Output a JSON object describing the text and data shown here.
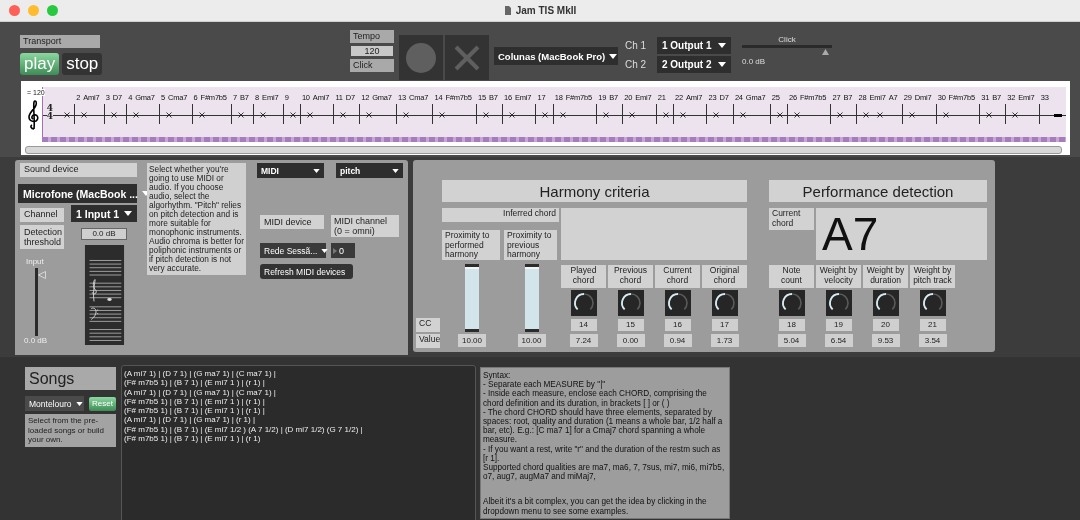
{
  "window": {
    "title": "Jam TIS MkII"
  },
  "transport": {
    "label": "Transport",
    "buttons": [
      {
        "label": "play",
        "selected": true
      },
      {
        "label": "stop",
        "selected": false
      }
    ]
  },
  "tempo": {
    "label": "Tempo",
    "value": "120",
    "click_label": "Click"
  },
  "audio_output": {
    "device": "Colunas (MacBook Pro)",
    "channels": [
      {
        "label": "Ch 1",
        "value": "1 Output 1"
      },
      {
        "label": "Ch 2",
        "value": "2 Output 2"
      }
    ],
    "click_volume": {
      "label": "Click",
      "level": 0.92,
      "reading": "0.0 dB"
    }
  },
  "score": {
    "tempo_mark": "= 120",
    "time_signature": [
      "4",
      "4"
    ],
    "measures": [
      {
        "kind": "chord"
      },
      {
        "kind": "chord",
        "number": "2",
        "chords": [
          "Ami7"
        ]
      },
      {
        "kind": "chord",
        "number": "3",
        "chords": [
          "D7"
        ]
      },
      {
        "kind": "chord",
        "number": "4",
        "chords": [
          "Gma7"
        ]
      },
      {
        "kind": "chord",
        "number": "5",
        "chords": [
          "Cma7"
        ]
      },
      {
        "kind": "chord",
        "number": "6",
        "chords": [
          "F#m7b5"
        ]
      },
      {
        "kind": "chord",
        "number": "7",
        "chords": [
          "B7"
        ]
      },
      {
        "kind": "chord",
        "number": "8",
        "chords": [
          "Emi7"
        ]
      },
      {
        "kind": "chord",
        "number": "9"
      },
      {
        "kind": "chord",
        "number": "10",
        "chords": [
          "Ami7"
        ]
      },
      {
        "kind": "chord",
        "number": "11",
        "chords": [
          "D7"
        ]
      },
      {
        "kind": "chord",
        "number": "12",
        "chords": [
          "Gma7"
        ]
      },
      {
        "kind": "chord",
        "number": "13",
        "chords": [
          "Cma7"
        ]
      },
      {
        "kind": "chord",
        "number": "14",
        "chords": [
          "F#m7b5"
        ]
      },
      {
        "kind": "chord",
        "number": "15",
        "chords": [
          "B7"
        ]
      },
      {
        "kind": "chord",
        "number": "16",
        "chords": [
          "Emi7"
        ]
      },
      {
        "kind": "chord",
        "number": "17"
      },
      {
        "kind": "chord",
        "number": "18",
        "chords": [
          "F#m7b5"
        ]
      },
      {
        "kind": "chord",
        "number": "19",
        "chords": [
          "B7"
        ]
      },
      {
        "kind": "chord",
        "number": "20",
        "chords": [
          "Emi7"
        ]
      },
      {
        "kind": "chord",
        "number": "21"
      },
      {
        "kind": "chord",
        "number": "22",
        "chords": [
          "Ami7"
        ]
      },
      {
        "kind": "chord",
        "number": "23",
        "chords": [
          "D7"
        ]
      },
      {
        "kind": "chord",
        "number": "24",
        "chords": [
          "Gma7"
        ]
      },
      {
        "kind": "chord",
        "number": "25"
      },
      {
        "kind": "chord",
        "number": "26",
        "chords": [
          "F#m7b5"
        ]
      },
      {
        "kind": "chord",
        "number": "27",
        "chords": [
          "B7"
        ]
      },
      {
        "kind": "chord",
        "number": "28",
        "chords": [
          "Emi7",
          "A7"
        ]
      },
      {
        "kind": "chord",
        "number": "29",
        "chords": [
          "Dmi7"
        ]
      },
      {
        "kind": "chord",
        "number": "30",
        "chords": [
          "F#m7b5"
        ]
      },
      {
        "kind": "chord",
        "number": "31",
        "chords": [
          "B7"
        ]
      },
      {
        "kind": "chord",
        "number": "32",
        "chords": [
          "Emi7"
        ]
      },
      {
        "kind": "rest",
        "number": "33"
      }
    ]
  },
  "sound_input": {
    "label": "Sound device",
    "device": "Microfone (MacBook ...",
    "channel_label": "Channel",
    "channel": "1 Input 1",
    "threshold_label": "Detection threshold",
    "threshold_reading": "0.0 dB",
    "input": {
      "label": "Input",
      "level": 0.95,
      "reading": "0.0 dB"
    }
  },
  "mode": {
    "description": "Select whether you're going to use MIDI or audio. If you choose audio, select the algorhythm. \"Pitch\" relies on pitch detection and is more suitable for monophonic instruments. Audio chroma is better for poliphonic instruments or if pitch detection is not very accurate.",
    "source": "MIDI",
    "algorithm": "pitch",
    "midi_device_label": "MIDI device",
    "midi_channel_label": "MIDI channel (0 = omni)",
    "midi_device": "Rede Sessã...",
    "midi_channel": "0",
    "refresh": "Refresh MIDI devices"
  },
  "harmony": {
    "title": "Harmony criteria",
    "inferred_label": "Inferred chord",
    "cc_label": "CC",
    "value_label": "Value",
    "sliders": [
      {
        "label": "Proximity to performed harmony",
        "level": 1,
        "value": "10.00"
      },
      {
        "label": "Proximity to previous harmony",
        "level": 1,
        "value": "10.00"
      }
    ],
    "dials": [
      {
        "label": "Played chord",
        "cc": "14",
        "value": "7.24"
      },
      {
        "label": "Previous chord",
        "cc": "15",
        "value": "0.00"
      },
      {
        "label": "Current chord",
        "cc": "16",
        "value": "0.94"
      },
      {
        "label": "Original chord",
        "cc": "17",
        "value": "1.73"
      }
    ]
  },
  "performance": {
    "title": "Performance detection",
    "current_label": "Current chord",
    "current_chord": "A7",
    "dials": [
      {
        "label": "Note count",
        "cc": "18",
        "value": "5.04"
      },
      {
        "label": "Weight by velocity",
        "cc": "19",
        "value": "6.54"
      },
      {
        "label": "Weight by duration",
        "cc": "20",
        "value": "9.53"
      },
      {
        "label": "Weight by pitch track",
        "cc": "21",
        "value": "3.54"
      }
    ]
  },
  "songs": {
    "title": "Songs",
    "song": "Montelouro",
    "reset": "Reset",
    "hint": "Select from the pre-loaded songs or build your own.",
    "lines": [
      "(A mi7 1) | (D 7 1) | (G ma7 1) | (C ma7 1) |",
      "(F# m7b5 1) | (B 7 1) | (E mi7 1 ) | (r 1) |",
      "(A mi7 1) | (D 7 1) | (G ma7 1) | (C ma7 1) |",
      "(F# m7b5 1) | (B 7 1) | (E mi7 1 ) | (r 1) |",
      "(F# m7b5 1) | (B 7 1) | (E mi7 1 ) | (r 1) |",
      "(A mi7 1) | (D 7 1) | (G ma7 1) | (r 1) |",
      "(F# m7b5 1) | (B 7 1) | (E mi7 1/2 ) (A 7 1/2) | (D mi7 1/2) (G 7 1/2) |",
      "(F# m7b5 1) | (B 7 1) | (E mi7 1 ) | (r 1)"
    ],
    "syntax": [
      "Syntax:",
      "- Separate each MEASURE by \"|\"",
      "- Inside each measure, enclose each CHORD, comprising the chord definition and its duration, in brackets [ ] or ( )",
      "- The chord CHORD should have three elements, separated by spaces: root, quality and duration (1 means a whole bar, 1/2 half a bar, etc). E.g.: [C ma7 1] for a Cmaj7 chord spanning a whole measure.",
      "- If you want a rest, write \"r\" and the duration of the restm such as [r 1].",
      "Supported chord qualities are ma7, ma6, 7, 7sus, mi7, mi6, mi7b5, o7, aug7, augMa7 and miMaj7,",
      "Albeit it's a bit complex, you can get the idea by clicking in the dropdown menu to see some examples."
    ]
  }
}
